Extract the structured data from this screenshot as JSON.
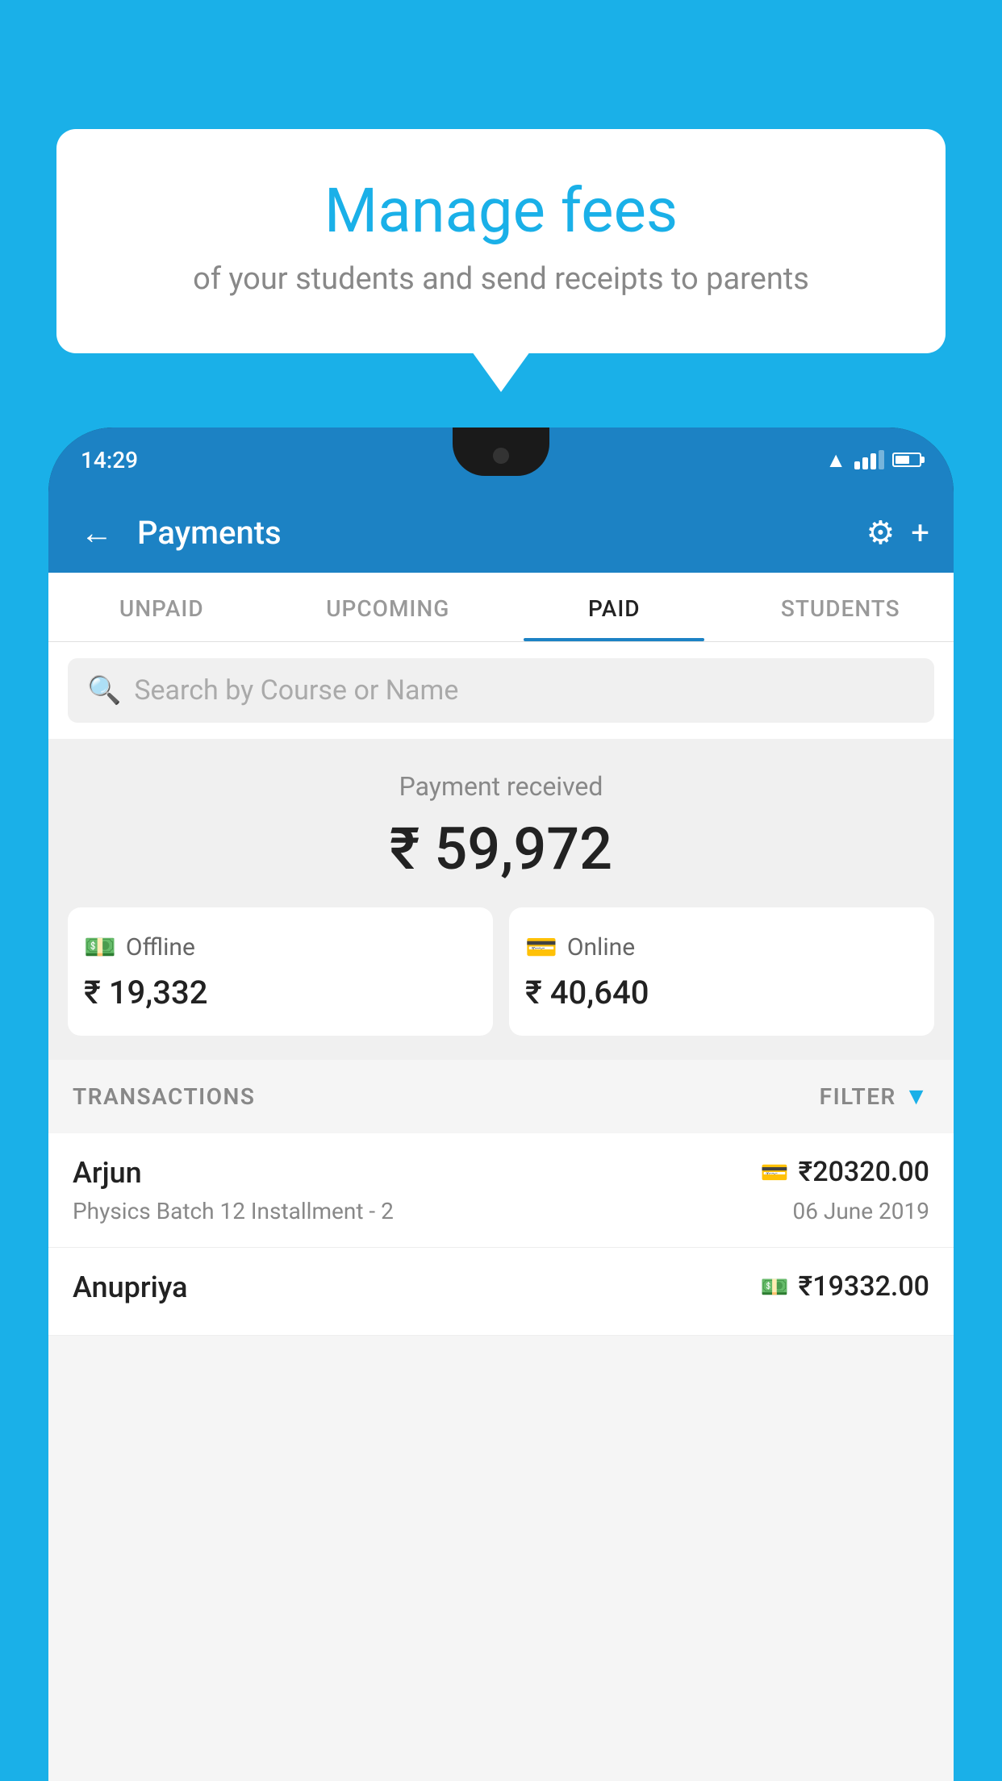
{
  "background_color": "#1ab0e8",
  "speech_bubble": {
    "title": "Manage fees",
    "subtitle": "of your students and send receipts to parents"
  },
  "phone": {
    "status_bar": {
      "time": "14:29",
      "wifi": true,
      "signal": true,
      "battery": true
    },
    "header": {
      "title": "Payments",
      "back_label": "←",
      "gear_label": "⚙",
      "plus_label": "+"
    },
    "tabs": [
      {
        "label": "UNPAID",
        "active": false
      },
      {
        "label": "UPCOMING",
        "active": false
      },
      {
        "label": "PAID",
        "active": true
      },
      {
        "label": "STUDENTS",
        "active": false
      }
    ],
    "search": {
      "placeholder": "Search by Course or Name"
    },
    "payment_summary": {
      "label": "Payment received",
      "total": "₹ 59,972",
      "offline_label": "Offline",
      "offline_amount": "₹ 19,332",
      "online_label": "Online",
      "online_amount": "₹ 40,640"
    },
    "transactions_section": {
      "label": "TRANSACTIONS",
      "filter_label": "FILTER"
    },
    "transactions": [
      {
        "name": "Arjun",
        "course": "Physics Batch 12 Installment - 2",
        "amount": "₹20320.00",
        "date": "06 June 2019",
        "payment_method": "card"
      },
      {
        "name": "Anupriya",
        "course": "",
        "amount": "₹19332.00",
        "date": "",
        "payment_method": "cash"
      }
    ]
  }
}
